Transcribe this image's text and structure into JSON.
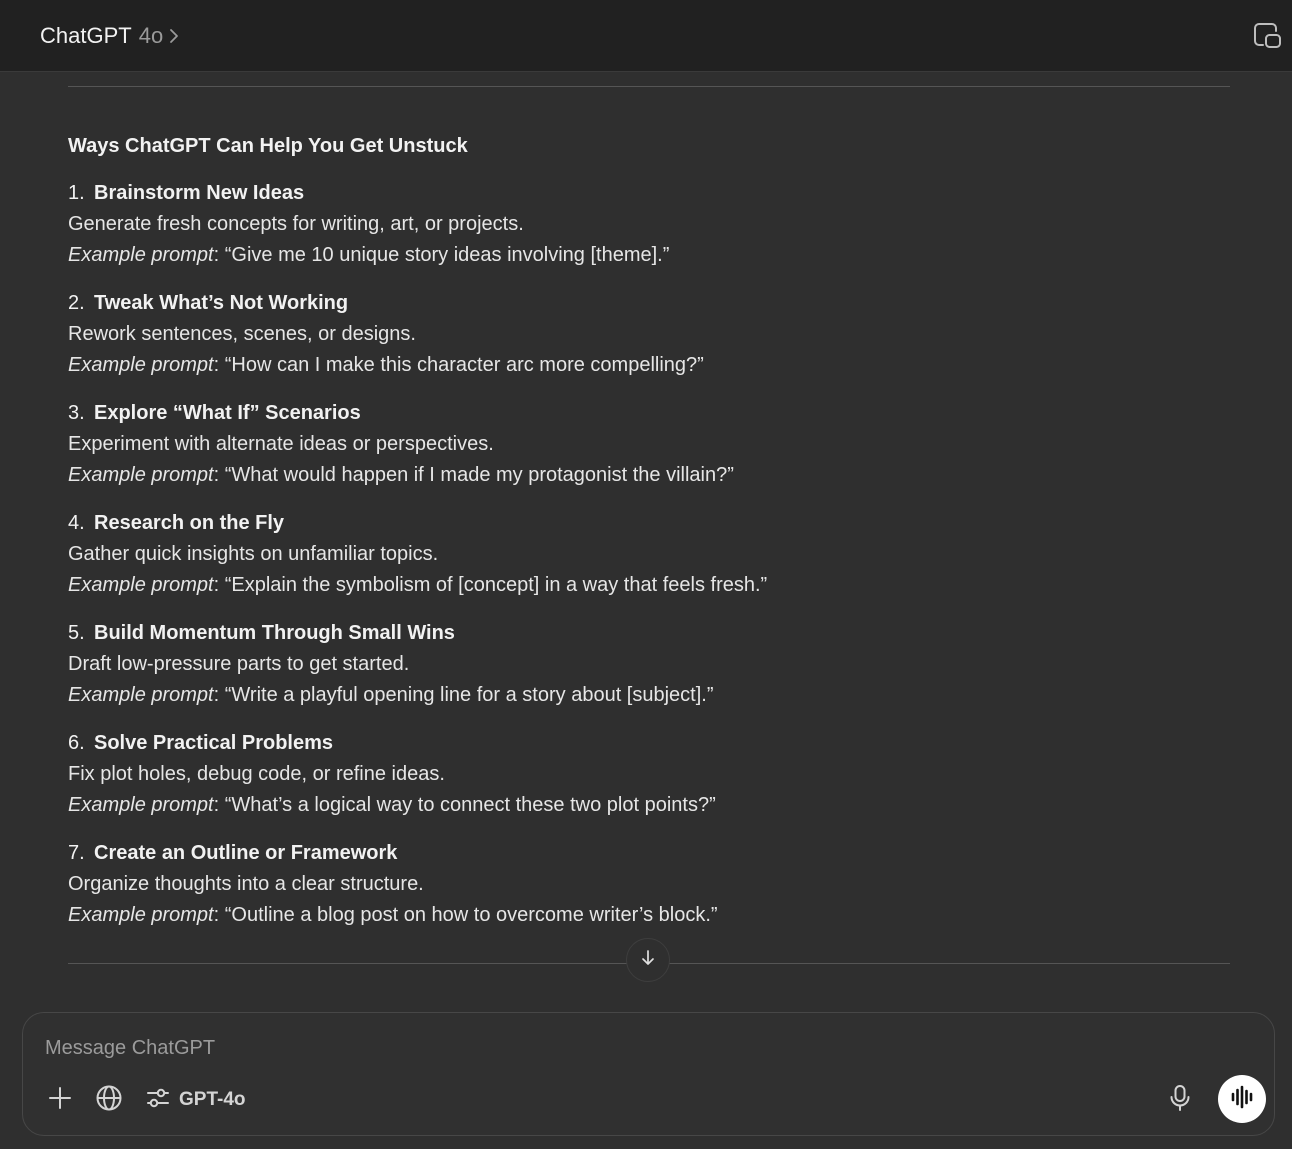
{
  "header": {
    "model_name": "ChatGPT",
    "model_version": "4o"
  },
  "response": {
    "heading": "Ways ChatGPT Can Help You Get Unstuck",
    "example_label": "Example prompt",
    "items": [
      {
        "number": "1.",
        "title": "Brainstorm New Ideas",
        "description": "Generate fresh concepts for writing, art, or projects.",
        "example": ": “Give me 10 unique story ideas involving [theme].”"
      },
      {
        "number": "2.",
        "title": "Tweak What’s Not Working",
        "description": "Rework sentences, scenes, or designs.",
        "example": ": “How can I make this character arc more compelling?”"
      },
      {
        "number": "3.",
        "title": "Explore “What If” Scenarios",
        "description": "Experiment with alternate ideas or perspectives.",
        "example": ": “What would happen if I made my protagonist the villain?”"
      },
      {
        "number": "4.",
        "title": "Research on the Fly",
        "description": "Gather quick insights on unfamiliar topics.",
        "example": ": “Explain the symbolism of [concept] in a way that feels fresh.”"
      },
      {
        "number": "5.",
        "title": "Build Momentum Through Small Wins",
        "description": "Draft low-pressure parts to get started.",
        "example": ": “Write a playful opening line for a story about [subject].”"
      },
      {
        "number": "6.",
        "title": "Solve Practical Problems",
        "description": "Fix plot holes, debug code, or refine ideas.",
        "example": ": “What’s a logical way to connect these two plot points?”"
      },
      {
        "number": "7.",
        "title": "Create an Outline or Framework",
        "description": "Organize thoughts into a clear structure.",
        "example": ": “Outline a blog post on how to overcome writer’s block.”"
      }
    ]
  },
  "composer": {
    "placeholder": "Message ChatGPT",
    "value": "",
    "tools_label": "GPT-4o"
  },
  "icons": {
    "header_chevron": "chevron-right-icon",
    "header_right": "new-window-icon",
    "scroll": "arrow-down-icon",
    "attach": "plus-icon",
    "search": "globe-icon",
    "tools": "sliders-icon",
    "dictate": "microphone-icon",
    "voice": "voice-waveform-icon"
  },
  "colors": {
    "background": "#2f2f2f",
    "header_background": "#212121",
    "text_primary": "#ececec",
    "text_muted": "#9b9b9b",
    "voice_button": "#ffffff"
  }
}
